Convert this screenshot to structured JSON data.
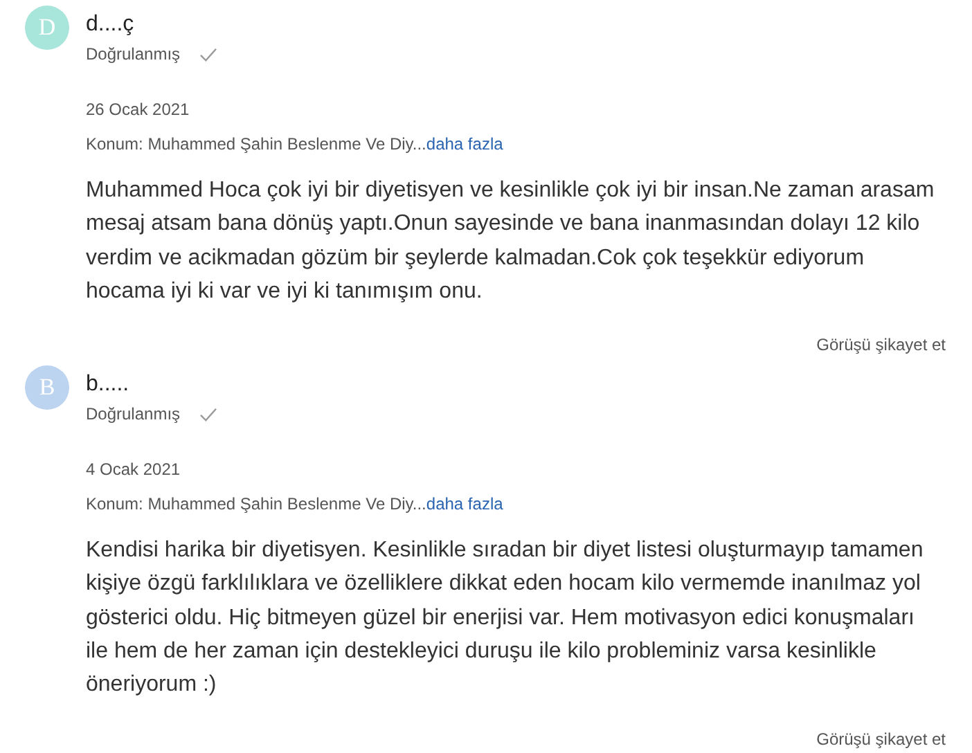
{
  "reviews": [
    {
      "avatar": {
        "letter": "D",
        "color": "#a8e6dc"
      },
      "name": "d....ç",
      "verified": "Doğrulanmış",
      "date": "26 Ocak 2021",
      "location": "Konum: Muhammed Şahin Beslenme Ve Diy...",
      "more": "daha fazla",
      "text": "Muhammed Hoca çok iyi bir diyetisyen ve kesinlikle çok iyi bir insan.Ne zaman arasam mesaj atsam bana dönüş yaptı.Onun sayesinde ve bana inanmasından dolayı 12 kilo verdim ve acikmadan gözüm bir şeylerde kalmadan.Cok çok teşekkür ediyorum hocama iyi ki var ve iyi ki tanımışım onu.",
      "report": "Görüşü şikayet et"
    },
    {
      "avatar": {
        "letter": "B",
        "color": "#bcd4f0"
      },
      "name": "b.....",
      "verified": "Doğrulanmış",
      "date": "4 Ocak 2021",
      "location": "Konum: Muhammed Şahin Beslenme Ve Diy...",
      "more": "daha fazla",
      "text": "Kendisi harika bir diyetisyen. Kesinlikle sıradan bir diyet listesi oluşturmayıp tamamen kişiye özgü farklılıklara ve özelliklere dikkat eden hocam kilo vermemde inanılmaz yol gösterici oldu. Hiç bitmeyen güzel bir enerjisi var. Hem motivasyon edici konuşmaları ile hem de her zaman için destekleyici duruşu ile kilo probleminiz varsa kesinlikle öneriyorum :)",
      "report": "Görüşü şikayet et"
    }
  ]
}
